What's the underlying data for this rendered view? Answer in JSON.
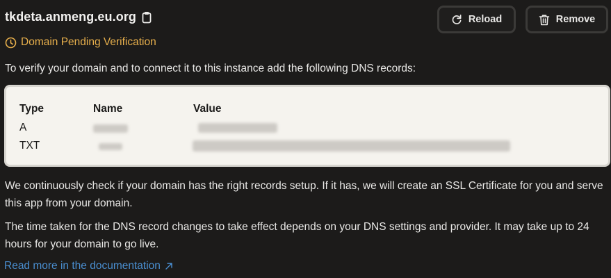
{
  "header": {
    "domain": "tkdeta.anmeng.eu.org",
    "copy_icon": "clipboard-icon"
  },
  "toolbar": {
    "reload_label": "Reload",
    "reload_icon": "refresh-icon",
    "remove_label": "Remove",
    "remove_icon": "trash-icon"
  },
  "status": {
    "text": "Domain Pending Verification",
    "icon": "clock-icon",
    "color": "#e8b04c"
  },
  "intro": "To verify your domain and to connect it to this instance add the following DNS records:",
  "dns_table": {
    "headers": {
      "type": "Type",
      "name": "Name",
      "value": "Value"
    },
    "rows": [
      {
        "type": "A",
        "name_redacted": true,
        "value_redacted": true
      },
      {
        "type": "TXT",
        "name_redacted": true,
        "value_redacted": true
      }
    ]
  },
  "paragraphs": {
    "check": "We continuously check if your domain has the right records setup. If it has, we will create an SSL Certificate for you and serve this app from your domain.",
    "timing": "The time taken for the DNS record changes to take effect depends on your DNS settings and provider. It may take up to 24 hours for your domain to go live."
  },
  "docs_link": {
    "label": "Read more in the documentation",
    "icon": "external-link-arrow-icon",
    "color": "#4a8fd1"
  }
}
